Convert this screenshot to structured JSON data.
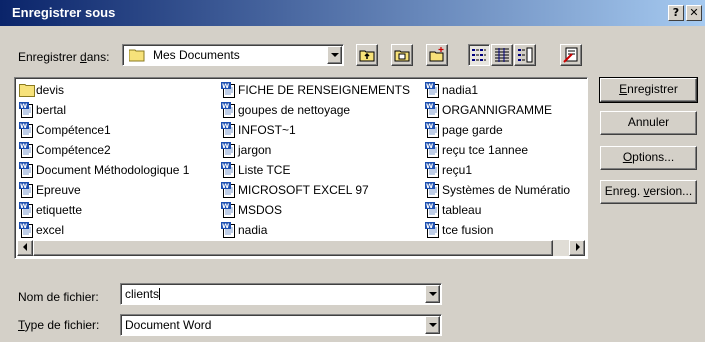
{
  "window": {
    "title": "Enregistrer sous",
    "help_button": "?",
    "close_button": "✕"
  },
  "location": {
    "label_prefix": "Enregistrer ",
    "label_accel": "d",
    "label_suffix": "ans:",
    "value": "Mes Documents"
  },
  "toolbar": {
    "icons": [
      "up-folder-icon",
      "desktop-icon",
      "new-folder-icon",
      "list-view-icon",
      "details-view-icon",
      "properties-view-icon",
      "tools-icon"
    ]
  },
  "files": {
    "col1": [
      {
        "name": "devis",
        "icon": "folder-icon"
      },
      {
        "name": "bertal",
        "icon": "word-doc-icon"
      },
      {
        "name": "Compétence1",
        "icon": "word-doc-icon"
      },
      {
        "name": "Compétence2",
        "icon": "word-doc-icon"
      },
      {
        "name": "Document Méthodologique 1",
        "icon": "word-doc-icon"
      },
      {
        "name": "Epreuve",
        "icon": "word-doc-icon"
      },
      {
        "name": "etiquette",
        "icon": "word-doc-icon"
      },
      {
        "name": "excel",
        "icon": "word-doc-icon"
      }
    ],
    "col2": [
      {
        "name": "FICHE DE RENSEIGNEMENTS",
        "icon": "word-doc-icon"
      },
      {
        "name": "goupes de nettoyage",
        "icon": "word-doc-icon"
      },
      {
        "name": "INFOST~1",
        "icon": "word-doc-icon"
      },
      {
        "name": "jargon",
        "icon": "word-doc-icon"
      },
      {
        "name": "Liste TCE",
        "icon": "word-doc-icon"
      },
      {
        "name": "MICROSOFT EXCEL 97",
        "icon": "word-doc-icon"
      },
      {
        "name": "MSDOS",
        "icon": "word-doc-icon"
      },
      {
        "name": "nadia",
        "icon": "word-doc-icon"
      }
    ],
    "col3": [
      {
        "name": "nadia1",
        "icon": "word-doc-icon"
      },
      {
        "name": "ORGANNIGRAMME",
        "icon": "word-doc-icon"
      },
      {
        "name": "page garde",
        "icon": "word-doc-icon"
      },
      {
        "name": "reçu tce 1annee",
        "icon": "word-doc-icon"
      },
      {
        "name": "reçu1",
        "icon": "word-doc-icon"
      },
      {
        "name": "Systèmes de Numératio",
        "icon": "word-doc-icon"
      },
      {
        "name": "tableau",
        "icon": "word-doc-icon"
      },
      {
        "name": "tce fusion",
        "icon": "word-doc-icon"
      }
    ]
  },
  "buttons": {
    "save": {
      "accel": "E",
      "rest": "nregistrer"
    },
    "cancel": {
      "label": "Annuler"
    },
    "options": {
      "accel": "O",
      "rest": "ptions..."
    },
    "version": {
      "prefix": "Enreg. ",
      "accel": "v",
      "rest": "ersion..."
    }
  },
  "filename": {
    "label_prefix": "",
    "label_main": "Nom de fichier:",
    "value": "clients"
  },
  "filetype": {
    "label_accel": "T",
    "label_rest": "ype de fichier:",
    "value": "Document Word"
  }
}
